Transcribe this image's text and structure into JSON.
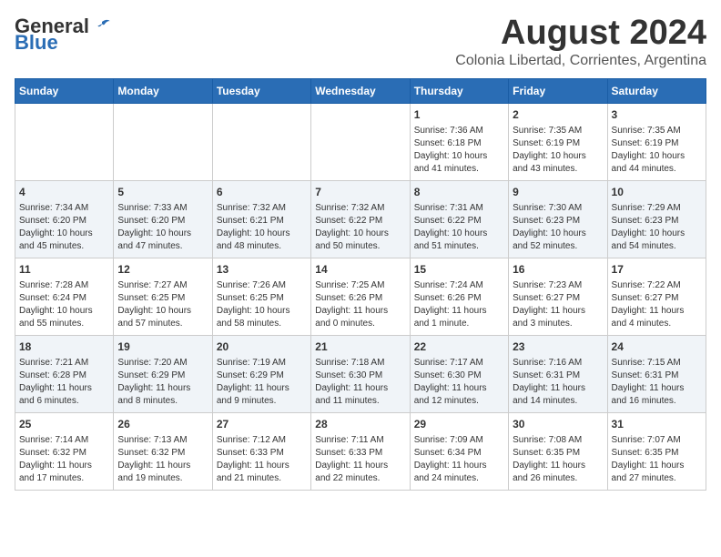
{
  "header": {
    "logo_general": "General",
    "logo_blue": "Blue",
    "month_title": "August 2024",
    "subtitle": "Colonia Libertad, Corrientes, Argentina"
  },
  "days_of_week": [
    "Sunday",
    "Monday",
    "Tuesday",
    "Wednesday",
    "Thursday",
    "Friday",
    "Saturday"
  ],
  "weeks": [
    [
      {
        "day": "",
        "info": ""
      },
      {
        "day": "",
        "info": ""
      },
      {
        "day": "",
        "info": ""
      },
      {
        "day": "",
        "info": ""
      },
      {
        "day": "1",
        "info": "Sunrise: 7:36 AM\nSunset: 6:18 PM\nDaylight: 10 hours\nand 41 minutes."
      },
      {
        "day": "2",
        "info": "Sunrise: 7:35 AM\nSunset: 6:19 PM\nDaylight: 10 hours\nand 43 minutes."
      },
      {
        "day": "3",
        "info": "Sunrise: 7:35 AM\nSunset: 6:19 PM\nDaylight: 10 hours\nand 44 minutes."
      }
    ],
    [
      {
        "day": "4",
        "info": "Sunrise: 7:34 AM\nSunset: 6:20 PM\nDaylight: 10 hours\nand 45 minutes."
      },
      {
        "day": "5",
        "info": "Sunrise: 7:33 AM\nSunset: 6:20 PM\nDaylight: 10 hours\nand 47 minutes."
      },
      {
        "day": "6",
        "info": "Sunrise: 7:32 AM\nSunset: 6:21 PM\nDaylight: 10 hours\nand 48 minutes."
      },
      {
        "day": "7",
        "info": "Sunrise: 7:32 AM\nSunset: 6:22 PM\nDaylight: 10 hours\nand 50 minutes."
      },
      {
        "day": "8",
        "info": "Sunrise: 7:31 AM\nSunset: 6:22 PM\nDaylight: 10 hours\nand 51 minutes."
      },
      {
        "day": "9",
        "info": "Sunrise: 7:30 AM\nSunset: 6:23 PM\nDaylight: 10 hours\nand 52 minutes."
      },
      {
        "day": "10",
        "info": "Sunrise: 7:29 AM\nSunset: 6:23 PM\nDaylight: 10 hours\nand 54 minutes."
      }
    ],
    [
      {
        "day": "11",
        "info": "Sunrise: 7:28 AM\nSunset: 6:24 PM\nDaylight: 10 hours\nand 55 minutes."
      },
      {
        "day": "12",
        "info": "Sunrise: 7:27 AM\nSunset: 6:25 PM\nDaylight: 10 hours\nand 57 minutes."
      },
      {
        "day": "13",
        "info": "Sunrise: 7:26 AM\nSunset: 6:25 PM\nDaylight: 10 hours\nand 58 minutes."
      },
      {
        "day": "14",
        "info": "Sunrise: 7:25 AM\nSunset: 6:26 PM\nDaylight: 11 hours\nand 0 minutes."
      },
      {
        "day": "15",
        "info": "Sunrise: 7:24 AM\nSunset: 6:26 PM\nDaylight: 11 hours\nand 1 minute."
      },
      {
        "day": "16",
        "info": "Sunrise: 7:23 AM\nSunset: 6:27 PM\nDaylight: 11 hours\nand 3 minutes."
      },
      {
        "day": "17",
        "info": "Sunrise: 7:22 AM\nSunset: 6:27 PM\nDaylight: 11 hours\nand 4 minutes."
      }
    ],
    [
      {
        "day": "18",
        "info": "Sunrise: 7:21 AM\nSunset: 6:28 PM\nDaylight: 11 hours\nand 6 minutes."
      },
      {
        "day": "19",
        "info": "Sunrise: 7:20 AM\nSunset: 6:29 PM\nDaylight: 11 hours\nand 8 minutes."
      },
      {
        "day": "20",
        "info": "Sunrise: 7:19 AM\nSunset: 6:29 PM\nDaylight: 11 hours\nand 9 minutes."
      },
      {
        "day": "21",
        "info": "Sunrise: 7:18 AM\nSunset: 6:30 PM\nDaylight: 11 hours\nand 11 minutes."
      },
      {
        "day": "22",
        "info": "Sunrise: 7:17 AM\nSunset: 6:30 PM\nDaylight: 11 hours\nand 12 minutes."
      },
      {
        "day": "23",
        "info": "Sunrise: 7:16 AM\nSunset: 6:31 PM\nDaylight: 11 hours\nand 14 minutes."
      },
      {
        "day": "24",
        "info": "Sunrise: 7:15 AM\nSunset: 6:31 PM\nDaylight: 11 hours\nand 16 minutes."
      }
    ],
    [
      {
        "day": "25",
        "info": "Sunrise: 7:14 AM\nSunset: 6:32 PM\nDaylight: 11 hours\nand 17 minutes."
      },
      {
        "day": "26",
        "info": "Sunrise: 7:13 AM\nSunset: 6:32 PM\nDaylight: 11 hours\nand 19 minutes."
      },
      {
        "day": "27",
        "info": "Sunrise: 7:12 AM\nSunset: 6:33 PM\nDaylight: 11 hours\nand 21 minutes."
      },
      {
        "day": "28",
        "info": "Sunrise: 7:11 AM\nSunset: 6:33 PM\nDaylight: 11 hours\nand 22 minutes."
      },
      {
        "day": "29",
        "info": "Sunrise: 7:09 AM\nSunset: 6:34 PM\nDaylight: 11 hours\nand 24 minutes."
      },
      {
        "day": "30",
        "info": "Sunrise: 7:08 AM\nSunset: 6:35 PM\nDaylight: 11 hours\nand 26 minutes."
      },
      {
        "day": "31",
        "info": "Sunrise: 7:07 AM\nSunset: 6:35 PM\nDaylight: 11 hours\nand 27 minutes."
      }
    ]
  ]
}
